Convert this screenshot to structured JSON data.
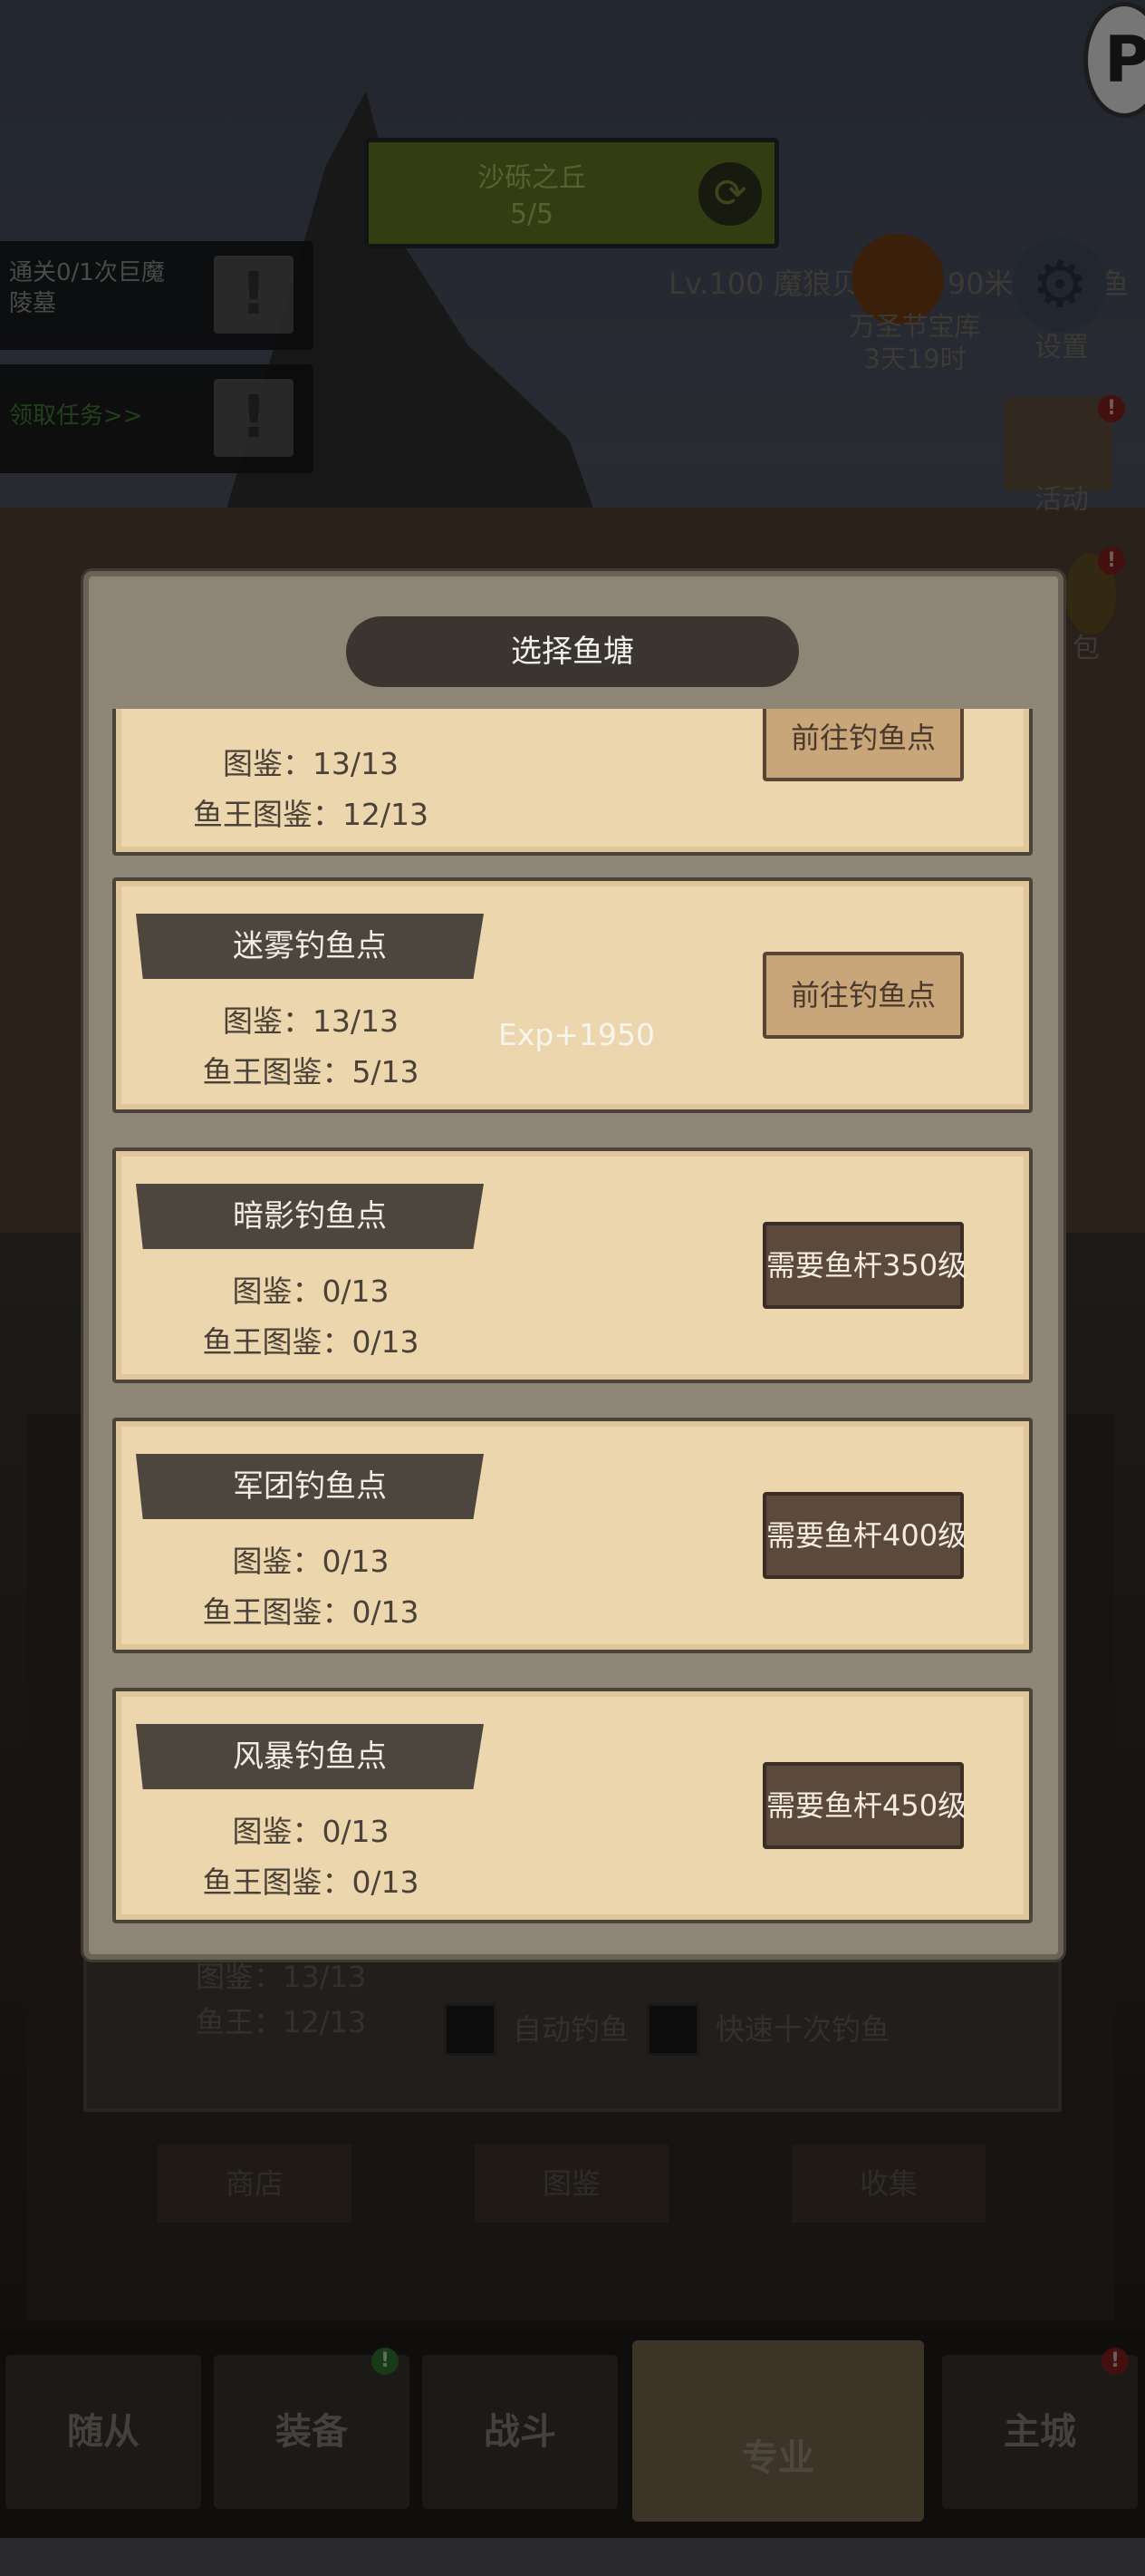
{
  "region": {
    "name": "沙砾之丘",
    "progress": "5/5"
  },
  "quests": [
    {
      "text": "通关0/1次巨魔陵墓"
    },
    {
      "text": "领取任务>>"
    }
  ],
  "top_info": "Lv.100 魔狼贝斯特：90米大佬摸鱼",
  "event": {
    "line1": "万圣节宝库",
    "line2": "3天19时"
  },
  "settings_label": "设置",
  "activity_label": "活动",
  "bag_label": "包",
  "corner_letter": "P",
  "badge_mark": "!",
  "modal": {
    "title": "选择鱼塘",
    "spots": [
      {
        "name": "",
        "collection": "图鉴：13/13",
        "king": "鱼王图鉴：12/13",
        "action": "前往钓鱼点",
        "unlocked": true
      },
      {
        "name": "迷雾钓鱼点",
        "collection": "图鉴：13/13",
        "king": "鱼王图鉴：5/13",
        "action": "前往钓鱼点",
        "unlocked": true,
        "exp": "Exp+1950"
      },
      {
        "name": "暗影钓鱼点",
        "collection": "图鉴：0/13",
        "king": "鱼王图鉴：0/13",
        "action": "需要鱼杆350级",
        "unlocked": false
      },
      {
        "name": "军团钓鱼点",
        "collection": "图鉴：0/13",
        "king": "鱼王图鉴：0/13",
        "action": "需要鱼杆400级",
        "unlocked": false
      },
      {
        "name": "风暴钓鱼点",
        "collection": "图鉴：0/13",
        "king": "鱼王图鉴：0/13",
        "action": "需要鱼杆450级",
        "unlocked": false
      }
    ]
  },
  "under_panel": {
    "collection": "图鉴：13/13",
    "king": "鱼王：12/13",
    "auto_fish": "自动钓鱼",
    "fast_ten": "快速十次钓鱼",
    "buttons": [
      "商店",
      "图鉴",
      "收集"
    ]
  },
  "nav": {
    "tabs": [
      "随从",
      "装备",
      "战斗",
      "专业",
      "主城"
    ],
    "selected": "专业"
  },
  "colors": {
    "parchment": "#ecd6ad",
    "name_bar": "#4d463f",
    "locked_button": "#5b4a3c",
    "go_button": "#c9a67a",
    "badge_red": "#7a1e1c"
  }
}
